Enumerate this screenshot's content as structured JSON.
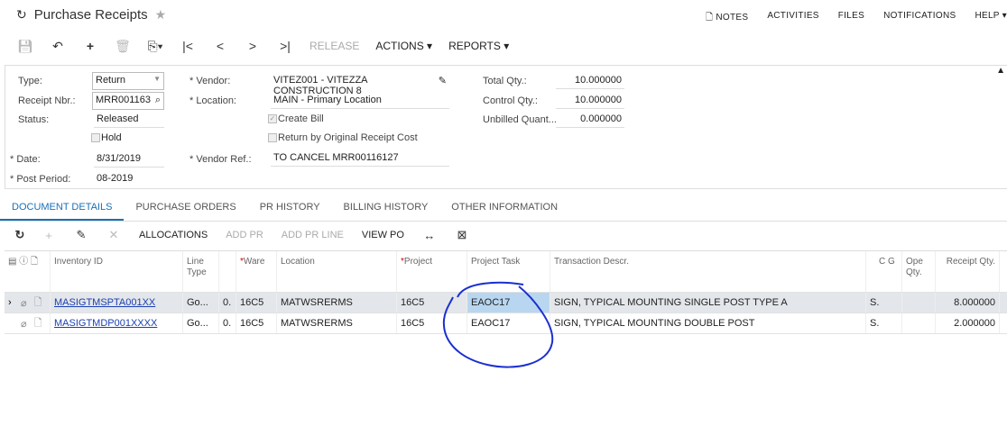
{
  "header": {
    "title": "Purchase Receipts",
    "nav": [
      "NOTES",
      "ACTIVITIES",
      "FILES",
      "NOTIFICATIONS",
      "HELP ▾"
    ]
  },
  "toolbar": {
    "release": "RELEASE",
    "actions": "ACTIONS ▾",
    "reports": "REPORTS ▾"
  },
  "form": {
    "type_label": "Type:",
    "type_value": "Return",
    "receipt_label": "Receipt Nbr.:",
    "receipt_value": "MRR001163",
    "status_label": "Status:",
    "status_value": "Released",
    "hold_label": "Hold",
    "date_label": "Date:",
    "date_value": "8/31/2019",
    "period_label": "Post Period:",
    "period_value": "08-2019",
    "vendor_label": "Vendor:",
    "vendor_value": "VITEZ001 - VITEZZA CONSTRUCTION 8",
    "location_label": "Location:",
    "location_value": "MAIN - Primary Location",
    "create_bill_label": "Create Bill",
    "return_orig_label": "Return by Original Receipt Cost",
    "vendor_ref_label": "Vendor Ref.:",
    "vendor_ref_value": "TO CANCEL MRR00116127",
    "total_qty_label": "Total Qty.:",
    "total_qty_value": "10.000000",
    "control_qty_label": "Control Qty.:",
    "control_qty_value": "10.000000",
    "unbilled_label": "Unbilled Quant...",
    "unbilled_value": "0.000000"
  },
  "tabs": [
    "DOCUMENT DETAILS",
    "PURCHASE ORDERS",
    "PR HISTORY",
    "BILLING HISTORY",
    "OTHER INFORMATION"
  ],
  "grid_toolbar": {
    "allocations": "ALLOCATIONS",
    "add_pr": "ADD PR",
    "add_pr_line": "ADD PR LINE",
    "view_po": "VIEW PO"
  },
  "columns": {
    "inventory": "Inventory ID",
    "line_type": "Line Type",
    "ware": "Ware",
    "location": "Location",
    "project": "Project",
    "task": "Project Task",
    "descr": "Transaction Descr.",
    "cg": "C G",
    "open_qty": "Ope Qty.",
    "receipt_qty": "Receipt Qty."
  },
  "rows": [
    {
      "inventory": "MASIGTMSPTA001XX",
      "line_type": "Go...",
      "x": "0.",
      "ware": "16C5",
      "location": "MATWSRERMS",
      "project": "16C5",
      "task": "EAOC17",
      "descr": "SIGN, TYPICAL MOUNTING SINGLE POST TYPE A",
      "uom": "S.",
      "receipt_qty": "8.000000"
    },
    {
      "inventory": "MASIGTMDP001XXXX",
      "line_type": "Go...",
      "x": "0.",
      "ware": "16C5",
      "location": "MATWSRERMS",
      "project": "16C5",
      "task": "EAOC17",
      "descr": "SIGN, TYPICAL MOUNTING DOUBLE POST",
      "uom": "S.",
      "receipt_qty": "2.000000"
    }
  ]
}
